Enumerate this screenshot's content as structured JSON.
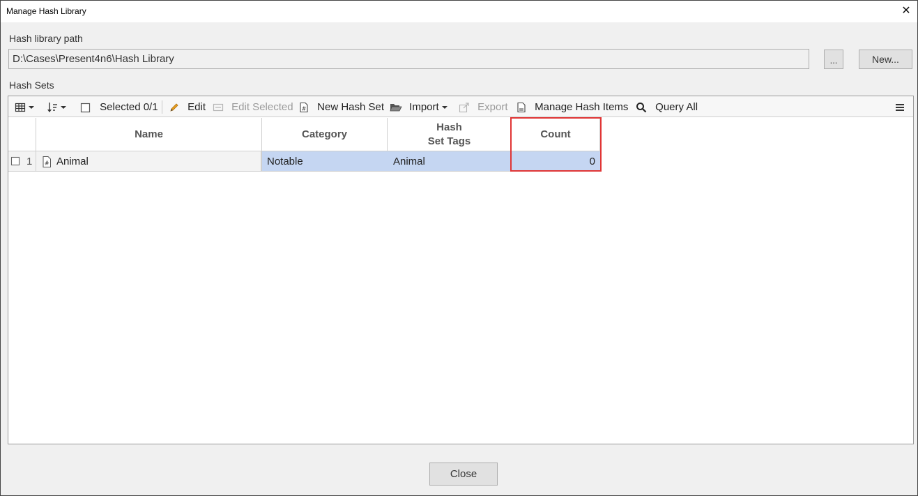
{
  "window": {
    "title": "Manage Hash Library",
    "close_glyph": "✕"
  },
  "path_section": {
    "label": "Hash library path",
    "value": "D:\\Cases\\Present4n6\\Hash Library",
    "browse_label": "...",
    "new_label": "New..."
  },
  "hash_sets_label": "Hash Sets",
  "toolbar": {
    "selected_label": "Selected 0/1",
    "edit_label": "Edit",
    "edit_selected_label": "Edit Selected",
    "new_hash_set_label": "New Hash Set",
    "import_label": "Import",
    "export_label": "Export",
    "manage_hash_items_label": "Manage Hash Items",
    "query_all_label": "Query All"
  },
  "table": {
    "columns": {
      "name": "Name",
      "category": "Category",
      "tags_line1": "Hash",
      "tags_line2": "Set Tags",
      "count": "Count"
    },
    "rows": [
      {
        "index": "1",
        "name": "Animal",
        "category": "Notable",
        "tags": "Animal",
        "count": "0"
      }
    ]
  },
  "footer": {
    "close_label": "Close"
  },
  "colors": {
    "selection": "#c5d6f2",
    "highlight": "#e03535"
  }
}
